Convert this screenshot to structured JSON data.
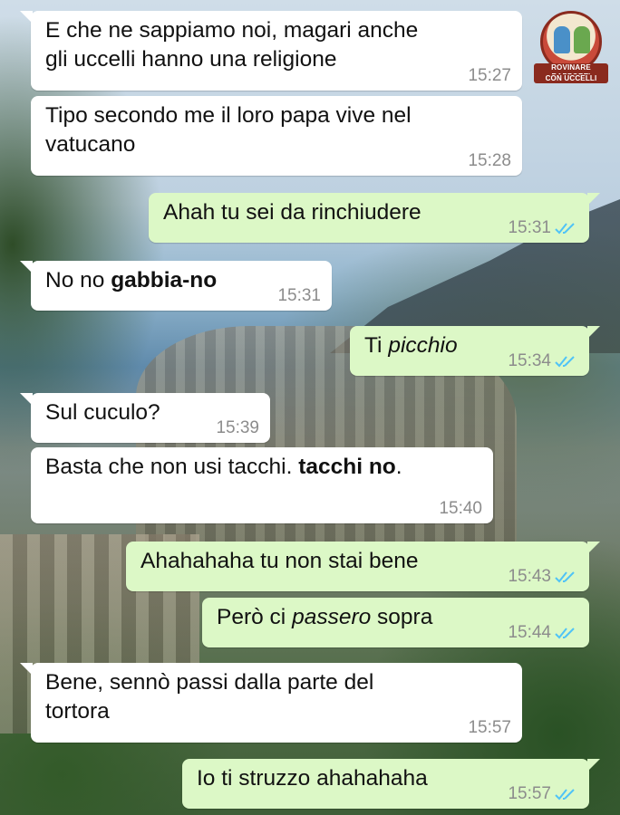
{
  "logo": {
    "line1": "ROVINARE RAPPORTI",
    "line2": "CON UCCELLI"
  },
  "messages": [
    {
      "dir": "in",
      "text": "E che ne sappiamo noi, magari anche\ngli uccelli hanno una religione",
      "time": "15:27"
    },
    {
      "dir": "in",
      "text": "Tipo secondo me il loro papa vive nel\nvatucano",
      "time": "15:28"
    },
    {
      "dir": "out",
      "text": "Ahah tu sei da rinchiudere",
      "time": "15:31",
      "read": true
    },
    {
      "dir": "in",
      "parts": [
        {
          "t": "No no "
        },
        {
          "t": "gabbia-no",
          "b": true
        }
      ],
      "time": "15:31"
    },
    {
      "dir": "out",
      "parts": [
        {
          "t": "Ti "
        },
        {
          "t": "picchio",
          "i": true
        }
      ],
      "time": "15:34",
      "read": true
    },
    {
      "dir": "in",
      "text": "Sul cuculo?",
      "time": "15:39"
    },
    {
      "dir": "in",
      "parts": [
        {
          "t": "Basta che non usi tacchi. "
        },
        {
          "t": "tacchi no",
          "b": true
        },
        {
          "t": "."
        }
      ],
      "time": "15:40"
    },
    {
      "dir": "out",
      "text": "Ahahahaha tu non stai bene",
      "time": "15:43",
      "read": true
    },
    {
      "dir": "out",
      "parts": [
        {
          "t": "Però ci "
        },
        {
          "t": "passero",
          "i": true
        },
        {
          "t": " sopra"
        }
      ],
      "time": "15:44",
      "read": true
    },
    {
      "dir": "in",
      "text": "Bene, sennò passi dalla parte del\ntortora",
      "time": "15:57"
    },
    {
      "dir": "out",
      "text": "Io ti struzzo ahahahaha",
      "time": "15:57",
      "read": true
    }
  ],
  "colors": {
    "incoming_bubble": "#ffffff",
    "outgoing_bubble": "#dcf8c6",
    "read_ticks": "#4fc3f7",
    "timestamp": "#8c8c8c"
  },
  "icons": {
    "read_receipt": "double-check-icon",
    "logo": "watermark-logo"
  }
}
